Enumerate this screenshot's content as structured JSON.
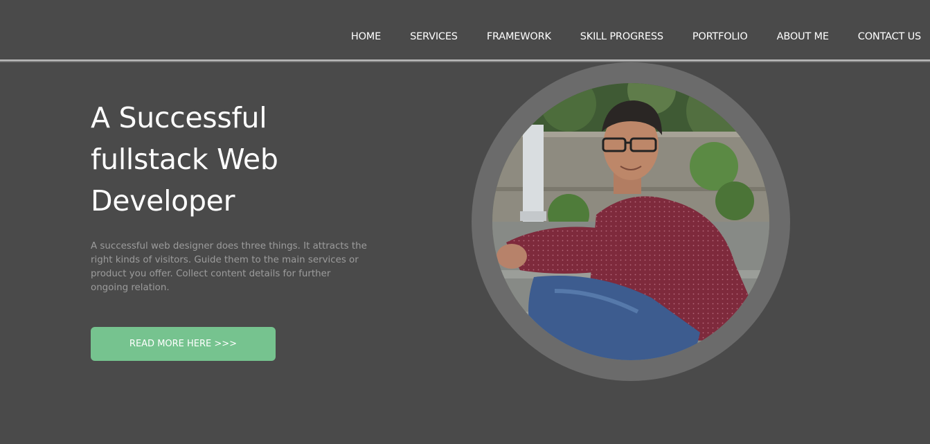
{
  "nav": {
    "items": [
      {
        "label": "HOME"
      },
      {
        "label": "SERVICES"
      },
      {
        "label": "FRAMEWORK"
      },
      {
        "label": "SKILL PROGRESS"
      },
      {
        "label": "PORTFOLIO"
      },
      {
        "label": "ABOUT ME"
      },
      {
        "label": "CONTACT US"
      }
    ]
  },
  "hero": {
    "title_line1": "A Successful",
    "title_line2": "fullstack Web",
    "title_line3": "Developer",
    "description": "A successful web designer does three things. It attracts the right kinds of visitors. Guide them to the main services or product you offer. Collect content details for further ongoing relation.",
    "cta_label": "READ MORE HERE >>>"
  },
  "colors": {
    "background": "#4a4a4a",
    "accent": "#76c38f",
    "ring": "#6b6b6b",
    "text": "#ffffff",
    "muted_text": "#9c9c9c"
  }
}
